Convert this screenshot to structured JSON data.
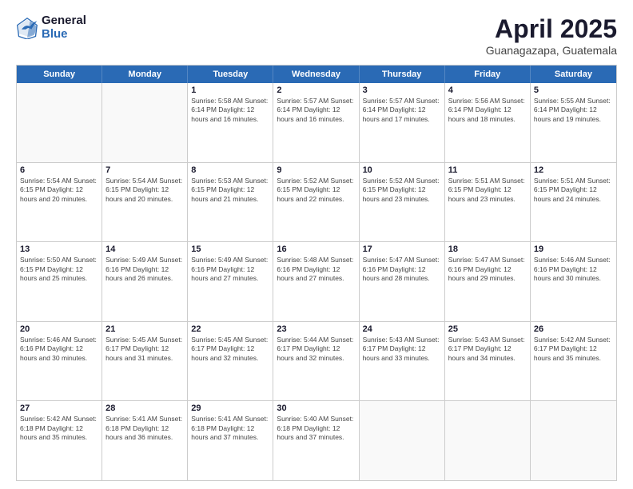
{
  "header": {
    "logo_general": "General",
    "logo_blue": "Blue",
    "title": "April 2025",
    "location": "Guanagazapa, Guatemala"
  },
  "days_of_week": [
    "Sunday",
    "Monday",
    "Tuesday",
    "Wednesday",
    "Thursday",
    "Friday",
    "Saturday"
  ],
  "weeks": [
    [
      {
        "day": "",
        "info": ""
      },
      {
        "day": "",
        "info": ""
      },
      {
        "day": "1",
        "info": "Sunrise: 5:58 AM\nSunset: 6:14 PM\nDaylight: 12 hours and 16 minutes."
      },
      {
        "day": "2",
        "info": "Sunrise: 5:57 AM\nSunset: 6:14 PM\nDaylight: 12 hours and 16 minutes."
      },
      {
        "day": "3",
        "info": "Sunrise: 5:57 AM\nSunset: 6:14 PM\nDaylight: 12 hours and 17 minutes."
      },
      {
        "day": "4",
        "info": "Sunrise: 5:56 AM\nSunset: 6:14 PM\nDaylight: 12 hours and 18 minutes."
      },
      {
        "day": "5",
        "info": "Sunrise: 5:55 AM\nSunset: 6:14 PM\nDaylight: 12 hours and 19 minutes."
      }
    ],
    [
      {
        "day": "6",
        "info": "Sunrise: 5:54 AM\nSunset: 6:15 PM\nDaylight: 12 hours and 20 minutes."
      },
      {
        "day": "7",
        "info": "Sunrise: 5:54 AM\nSunset: 6:15 PM\nDaylight: 12 hours and 20 minutes."
      },
      {
        "day": "8",
        "info": "Sunrise: 5:53 AM\nSunset: 6:15 PM\nDaylight: 12 hours and 21 minutes."
      },
      {
        "day": "9",
        "info": "Sunrise: 5:52 AM\nSunset: 6:15 PM\nDaylight: 12 hours and 22 minutes."
      },
      {
        "day": "10",
        "info": "Sunrise: 5:52 AM\nSunset: 6:15 PM\nDaylight: 12 hours and 23 minutes."
      },
      {
        "day": "11",
        "info": "Sunrise: 5:51 AM\nSunset: 6:15 PM\nDaylight: 12 hours and 23 minutes."
      },
      {
        "day": "12",
        "info": "Sunrise: 5:51 AM\nSunset: 6:15 PM\nDaylight: 12 hours and 24 minutes."
      }
    ],
    [
      {
        "day": "13",
        "info": "Sunrise: 5:50 AM\nSunset: 6:15 PM\nDaylight: 12 hours and 25 minutes."
      },
      {
        "day": "14",
        "info": "Sunrise: 5:49 AM\nSunset: 6:16 PM\nDaylight: 12 hours and 26 minutes."
      },
      {
        "day": "15",
        "info": "Sunrise: 5:49 AM\nSunset: 6:16 PM\nDaylight: 12 hours and 27 minutes."
      },
      {
        "day": "16",
        "info": "Sunrise: 5:48 AM\nSunset: 6:16 PM\nDaylight: 12 hours and 27 minutes."
      },
      {
        "day": "17",
        "info": "Sunrise: 5:47 AM\nSunset: 6:16 PM\nDaylight: 12 hours and 28 minutes."
      },
      {
        "day": "18",
        "info": "Sunrise: 5:47 AM\nSunset: 6:16 PM\nDaylight: 12 hours and 29 minutes."
      },
      {
        "day": "19",
        "info": "Sunrise: 5:46 AM\nSunset: 6:16 PM\nDaylight: 12 hours and 30 minutes."
      }
    ],
    [
      {
        "day": "20",
        "info": "Sunrise: 5:46 AM\nSunset: 6:16 PM\nDaylight: 12 hours and 30 minutes."
      },
      {
        "day": "21",
        "info": "Sunrise: 5:45 AM\nSunset: 6:17 PM\nDaylight: 12 hours and 31 minutes."
      },
      {
        "day": "22",
        "info": "Sunrise: 5:45 AM\nSunset: 6:17 PM\nDaylight: 12 hours and 32 minutes."
      },
      {
        "day": "23",
        "info": "Sunrise: 5:44 AM\nSunset: 6:17 PM\nDaylight: 12 hours and 32 minutes."
      },
      {
        "day": "24",
        "info": "Sunrise: 5:43 AM\nSunset: 6:17 PM\nDaylight: 12 hours and 33 minutes."
      },
      {
        "day": "25",
        "info": "Sunrise: 5:43 AM\nSunset: 6:17 PM\nDaylight: 12 hours and 34 minutes."
      },
      {
        "day": "26",
        "info": "Sunrise: 5:42 AM\nSunset: 6:17 PM\nDaylight: 12 hours and 35 minutes."
      }
    ],
    [
      {
        "day": "27",
        "info": "Sunrise: 5:42 AM\nSunset: 6:18 PM\nDaylight: 12 hours and 35 minutes."
      },
      {
        "day": "28",
        "info": "Sunrise: 5:41 AM\nSunset: 6:18 PM\nDaylight: 12 hours and 36 minutes."
      },
      {
        "day": "29",
        "info": "Sunrise: 5:41 AM\nSunset: 6:18 PM\nDaylight: 12 hours and 37 minutes."
      },
      {
        "day": "30",
        "info": "Sunrise: 5:40 AM\nSunset: 6:18 PM\nDaylight: 12 hours and 37 minutes."
      },
      {
        "day": "",
        "info": ""
      },
      {
        "day": "",
        "info": ""
      },
      {
        "day": "",
        "info": ""
      }
    ]
  ]
}
